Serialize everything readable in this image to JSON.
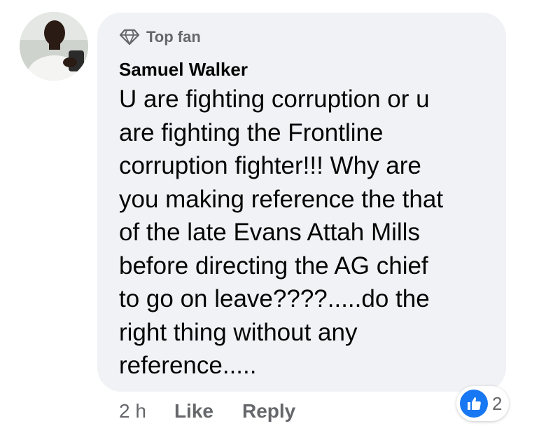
{
  "comment": {
    "badge_label": "Top fan",
    "author": "Samuel Walker",
    "text": "U are fighting corruption or u\nare fighting the Frontline\ncorruption fighter!!! Why are\nyou making reference the that\nof the late Evans Attah Mills\nbefore directing the AG chief\nto go on leave????.....do the\nright thing without any\nreference.....",
    "timestamp": "2 h",
    "like_label": "Like",
    "reply_label": "Reply",
    "reaction_count": "2"
  },
  "icons": {
    "badge": "diamond-icon",
    "reaction": "thumbs-up-icon"
  },
  "colors": {
    "bubble_bg": "#f0f2f5",
    "secondary_text": "#65676b",
    "primary_text": "#050505",
    "like_blue": "#1877f2"
  }
}
